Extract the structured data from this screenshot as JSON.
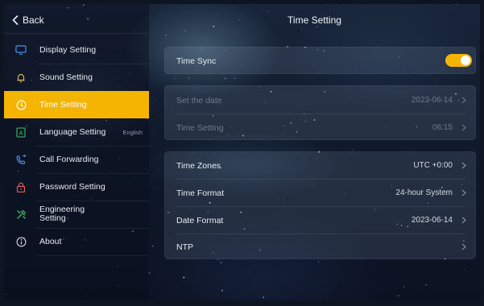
{
  "header": {
    "back_label": "Back",
    "title": "Time Setting"
  },
  "sidebar": {
    "items": [
      {
        "label": "Display Setting",
        "icon": "monitor-icon"
      },
      {
        "label": "Sound Setting",
        "icon": "bell-icon"
      },
      {
        "label": "Time Setting",
        "icon": "clock-icon",
        "active": true
      },
      {
        "label": "Language Setting",
        "extra": "English",
        "icon": "language-icon"
      },
      {
        "label": "Call Forwarding",
        "icon": "phone-forward-icon"
      },
      {
        "label": "Password Setting",
        "icon": "lock-icon"
      },
      {
        "label_line1": "Engineering",
        "label_line2": "Setting",
        "icon": "tools-icon"
      },
      {
        "label": "About",
        "icon": "info-icon"
      }
    ]
  },
  "sync_card": {
    "time_sync": {
      "label": "Time Sync",
      "enabled": true
    }
  },
  "manual_card": {
    "set_date": {
      "label": "Set the date",
      "value": "2023-06-14",
      "enabled": false
    },
    "set_time": {
      "label": "Time Setting",
      "value": "06:15",
      "enabled": false
    }
  },
  "options_card": {
    "time_zones": {
      "label": "Time Zones",
      "value": "UTC +0:00"
    },
    "time_format": {
      "label": "Time Format",
      "value": "24-hour System"
    },
    "date_format": {
      "label": "Date Format",
      "value": "2023-06-14"
    },
    "ntp": {
      "label": "NTP"
    }
  },
  "colors": {
    "accent": "#f4b400",
    "sound_icon": "#d8b24a",
    "call_icon": "#5a8fe0",
    "lock_icon": "#e25a5a",
    "tools_icon": "#3fbf6a",
    "language_icon": "#3fbf6a",
    "monitor_icon": "#4b8fe8"
  }
}
